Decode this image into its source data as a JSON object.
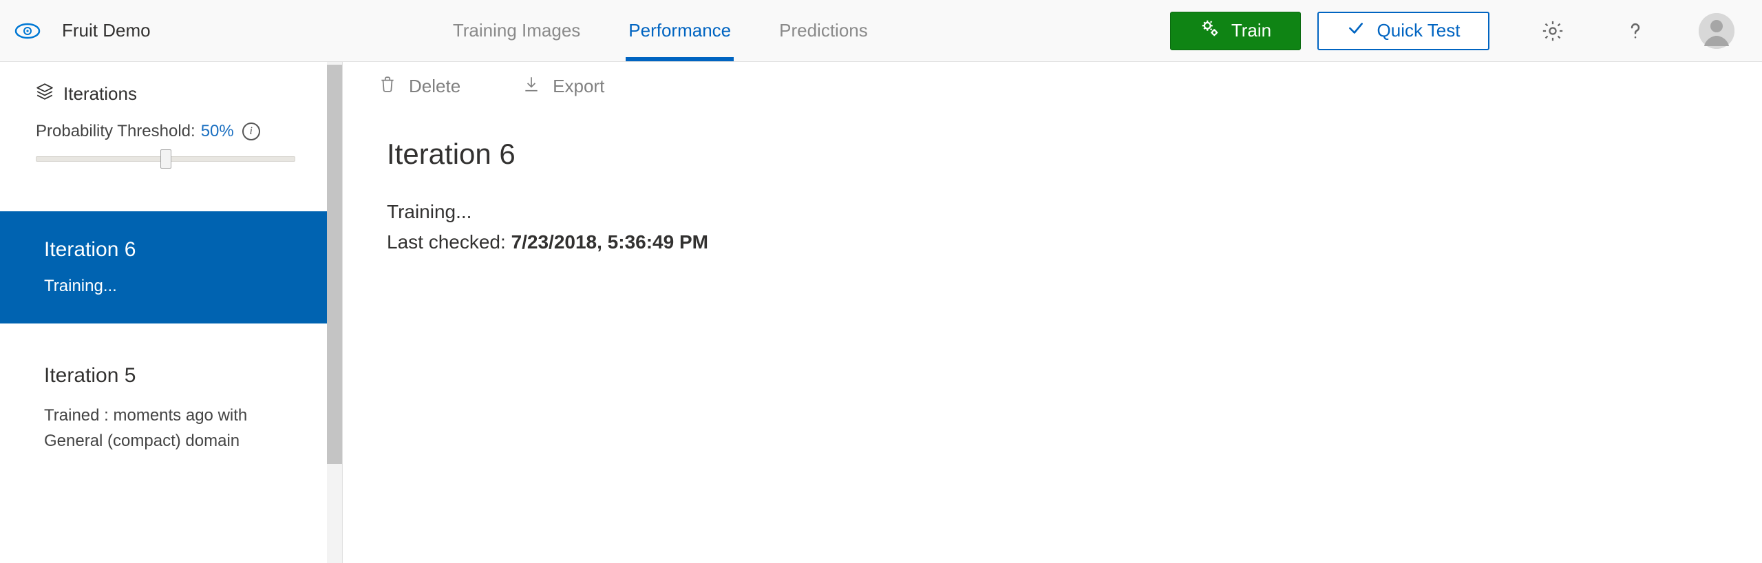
{
  "brand": {
    "title": "Fruit Demo"
  },
  "nav": {
    "training_images": "Training Images",
    "performance": "Performance",
    "predictions": "Predictions",
    "active": "performance"
  },
  "buttons": {
    "train": "Train",
    "quick_test": "Quick Test"
  },
  "toolbar": {
    "delete": "Delete",
    "export": "Export"
  },
  "sidebar": {
    "header": "Iterations",
    "threshold_label": "Probability Threshold:",
    "threshold_value": "50%",
    "iterations": [
      {
        "title": "Iteration 6",
        "status": "Training...",
        "selected": true
      },
      {
        "title": "Iteration 5",
        "status": "Trained : moments ago with General (compact) domain",
        "selected": false
      }
    ]
  },
  "main": {
    "title": "Iteration 6",
    "status": "Training...",
    "last_checked_label": "Last checked: ",
    "last_checked_value": "7/23/2018, 5:36:49 PM"
  }
}
